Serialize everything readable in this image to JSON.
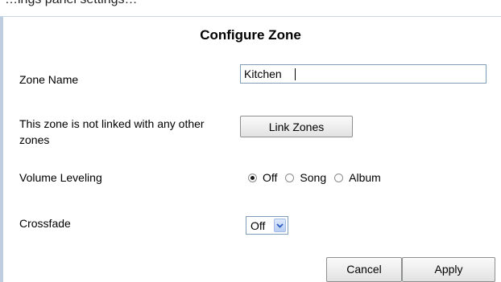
{
  "header_fragment": "…ings panel settings…",
  "title": "Configure Zone",
  "zone_name": {
    "label": "Zone Name",
    "value": "Kitchen"
  },
  "link": {
    "status_text": "This zone is not linked with any other zones",
    "button_label": "Link Zones"
  },
  "volume_leveling": {
    "label": "Volume Leveling",
    "options": [
      {
        "label": "Off",
        "selected": true
      },
      {
        "label": "Song",
        "selected": false
      },
      {
        "label": "Album",
        "selected": false
      }
    ]
  },
  "crossfade": {
    "label": "Crossfade",
    "selected": "Off",
    "icon": "chevron-down-icon"
  },
  "actions": {
    "cancel_label": "Cancel",
    "apply_label": "Apply"
  },
  "colors": {
    "input_border": "#7f9db9",
    "dropdown_arrow": "#2c5bc2"
  }
}
